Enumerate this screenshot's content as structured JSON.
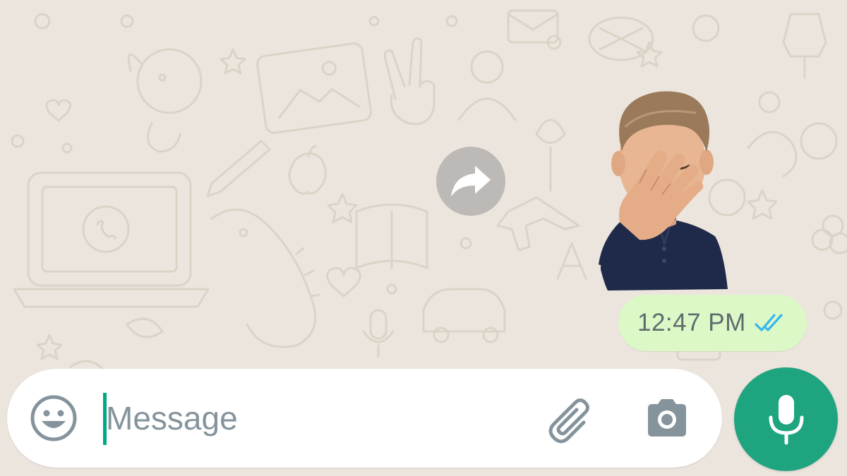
{
  "chat": {
    "background_color": "#ece5dd",
    "doodle_color": "#ddd4c8"
  },
  "forward_button": {
    "icon": "forward-arrow-icon",
    "color": "#969696"
  },
  "message": {
    "sticker": "facepalm-avatar-sticker",
    "time": "12:47 PM",
    "status_icon": "double-check-read-icon",
    "status_color": "#34b7f1",
    "bubble_color": "#dcf8c6"
  },
  "composer": {
    "placeholder": "Message",
    "emoji_icon": "smiley-icon",
    "attach_icon": "paperclip-icon",
    "camera_icon": "camera-icon",
    "send_icon": "microphone-icon",
    "accent_color": "#1fa480"
  }
}
